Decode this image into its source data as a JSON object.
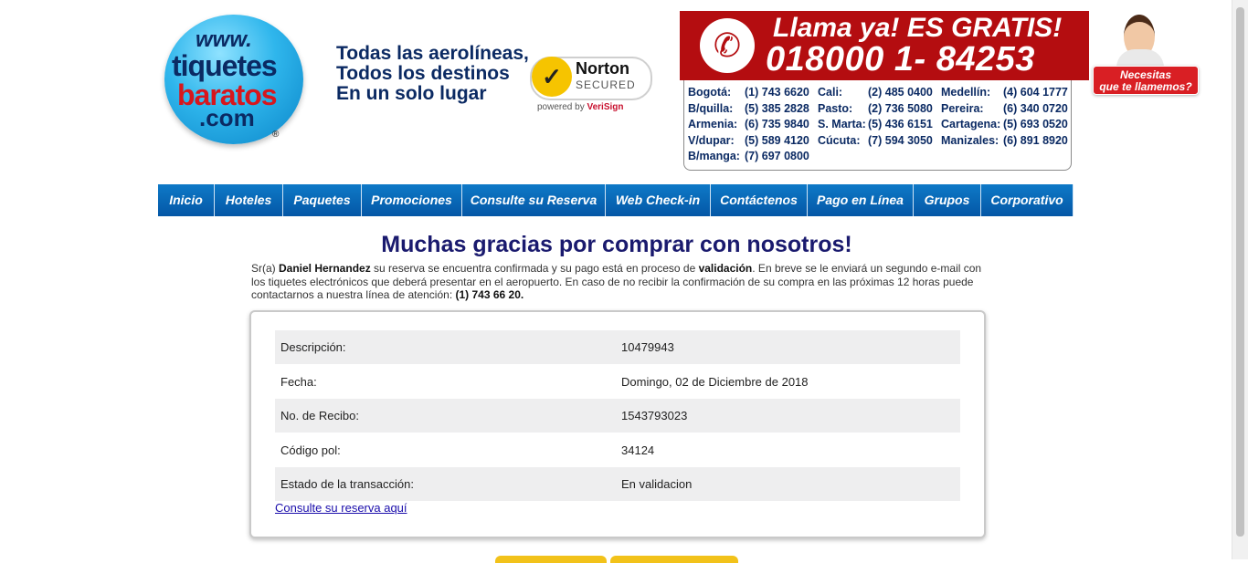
{
  "logo": {
    "www": "www.",
    "line1": "tiquetes",
    "line2": "baratos",
    "line3": ".com",
    "reg": "®"
  },
  "slogan": {
    "line1": "Todas las aerolíneas,",
    "line2": "Todos los destinos",
    "line3": "En un solo lugar"
  },
  "norton": {
    "name": "Norton",
    "secured": "SECURED",
    "powered": "powered by",
    "brand": "VeriSign"
  },
  "call": {
    "headline": "Llama ya! ES GRATIS!",
    "number": "018000 1- 84253"
  },
  "cities": [
    [
      {
        "city": "Bogotá:",
        "phone": "(1) 743 6620"
      },
      {
        "city": "Cali:",
        "phone": "(2) 485 0400"
      },
      {
        "city": "Medellín:",
        "phone": "(4) 604 1777"
      }
    ],
    [
      {
        "city": "B/quilla:",
        "phone": "(5) 385 2828"
      },
      {
        "city": "Pasto:",
        "phone": "(2) 736 5080"
      },
      {
        "city": "Pereira:",
        "phone": "(6) 340 0720"
      }
    ],
    [
      {
        "city": "Armenia:",
        "phone": "(6) 735 9840"
      },
      {
        "city": "S. Marta:",
        "phone": "(5) 436 6151"
      },
      {
        "city": "Cartagena:",
        "phone": "(5) 693 0520"
      }
    ],
    [
      {
        "city": "V/dupar:",
        "phone": "(5) 589 4120"
      },
      {
        "city": "Cúcuta:",
        "phone": "(7) 594 3050"
      },
      {
        "city": "Manizales:",
        "phone": "(6) 891 8920"
      }
    ],
    [
      {
        "city": "B/manga:",
        "phone": "(7) 697 0800"
      }
    ]
  ],
  "callback": {
    "line1": "Necesitas",
    "line2": "que te llamemos?"
  },
  "nav": [
    {
      "label": "Inicio"
    },
    {
      "label": "Hoteles"
    },
    {
      "label": "Paquetes"
    },
    {
      "label": "Promociones"
    },
    {
      "label": "Consulte su Reserva"
    },
    {
      "label": "Web Check-in"
    },
    {
      "label": "Contáctenos"
    },
    {
      "label": "Pago en Línea"
    },
    {
      "label": "Grupos"
    },
    {
      "label": "Corporativo"
    }
  ],
  "thanks_title": "Muchas gracias por comprar con nosotros!",
  "intro": {
    "prefix": "Sr(a) ",
    "name": "Daniel Hernandez",
    "part1": " su reserva se encuentra confirmada y su pago está en proceso de ",
    "validation": "validación",
    "part2": ". En breve se le enviará un segundo e-mail con los tiquetes electrónicos que deberá presentar en el aeropuerto. En caso de no recibir la confirmación de su compra en las próximas 12 horas puede contactarnos a nuestra línea de atención: ",
    "phone": "(1) 743 66 20."
  },
  "details": [
    {
      "label": "Descripción:",
      "value": "10479943"
    },
    {
      "label": "Fecha:",
      "value": "Domingo, 02 de Diciembre de 2018"
    },
    {
      "label": "No. de Recibo:",
      "value": "1543793023"
    },
    {
      "label": "Código pol:",
      "value": "34124"
    },
    {
      "label": "Estado de la transacción:",
      "value": "En validacion"
    }
  ],
  "consult_link": "Consulte su reserva aquí",
  "colors": {
    "nav": "#0457a6",
    "call": "#b40d10",
    "title": "#1a1a6e"
  }
}
